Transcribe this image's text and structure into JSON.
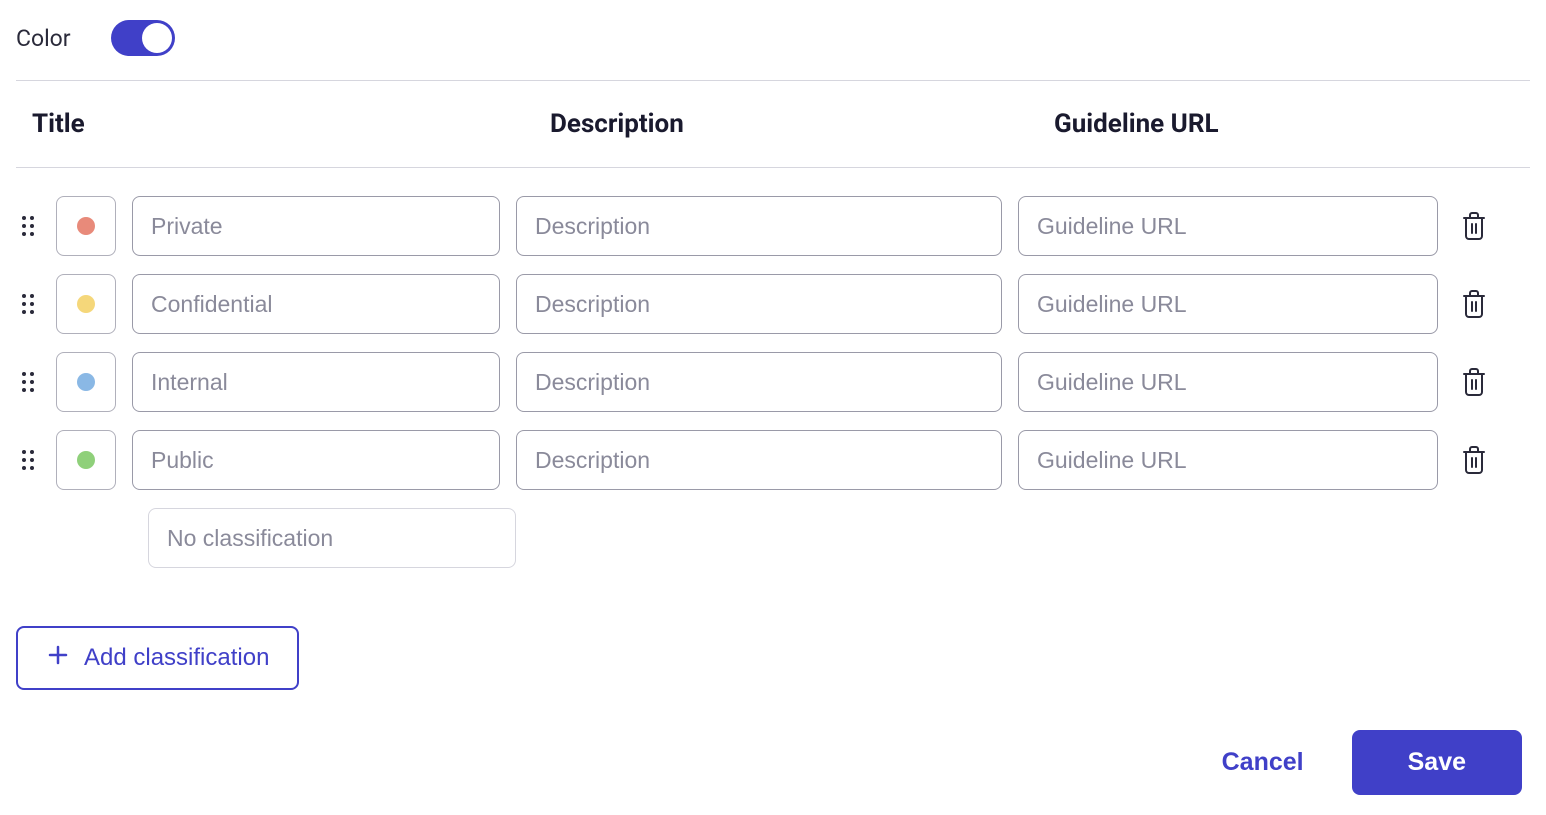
{
  "color_toggle": {
    "label": "Color",
    "on": true
  },
  "headers": {
    "title": "Title",
    "description": "Description",
    "url": "Guideline URL"
  },
  "rows": [
    {
      "color": "#e88a7a",
      "title_placeholder": "Private",
      "desc_placeholder": "Description",
      "url_placeholder": "Guideline URL"
    },
    {
      "color": "#f5d77a",
      "title_placeholder": "Confidential",
      "desc_placeholder": "Description",
      "url_placeholder": "Guideline URL"
    },
    {
      "color": "#8ab8e5",
      "title_placeholder": "Internal",
      "desc_placeholder": "Description",
      "url_placeholder": "Guideline URL"
    },
    {
      "color": "#8fd07a",
      "title_placeholder": "Public",
      "desc_placeholder": "Description",
      "url_placeholder": "Guideline URL"
    }
  ],
  "no_classification": {
    "placeholder": "No classification"
  },
  "add_button": {
    "label": "Add classification"
  },
  "footer": {
    "cancel": "Cancel",
    "save": "Save"
  }
}
